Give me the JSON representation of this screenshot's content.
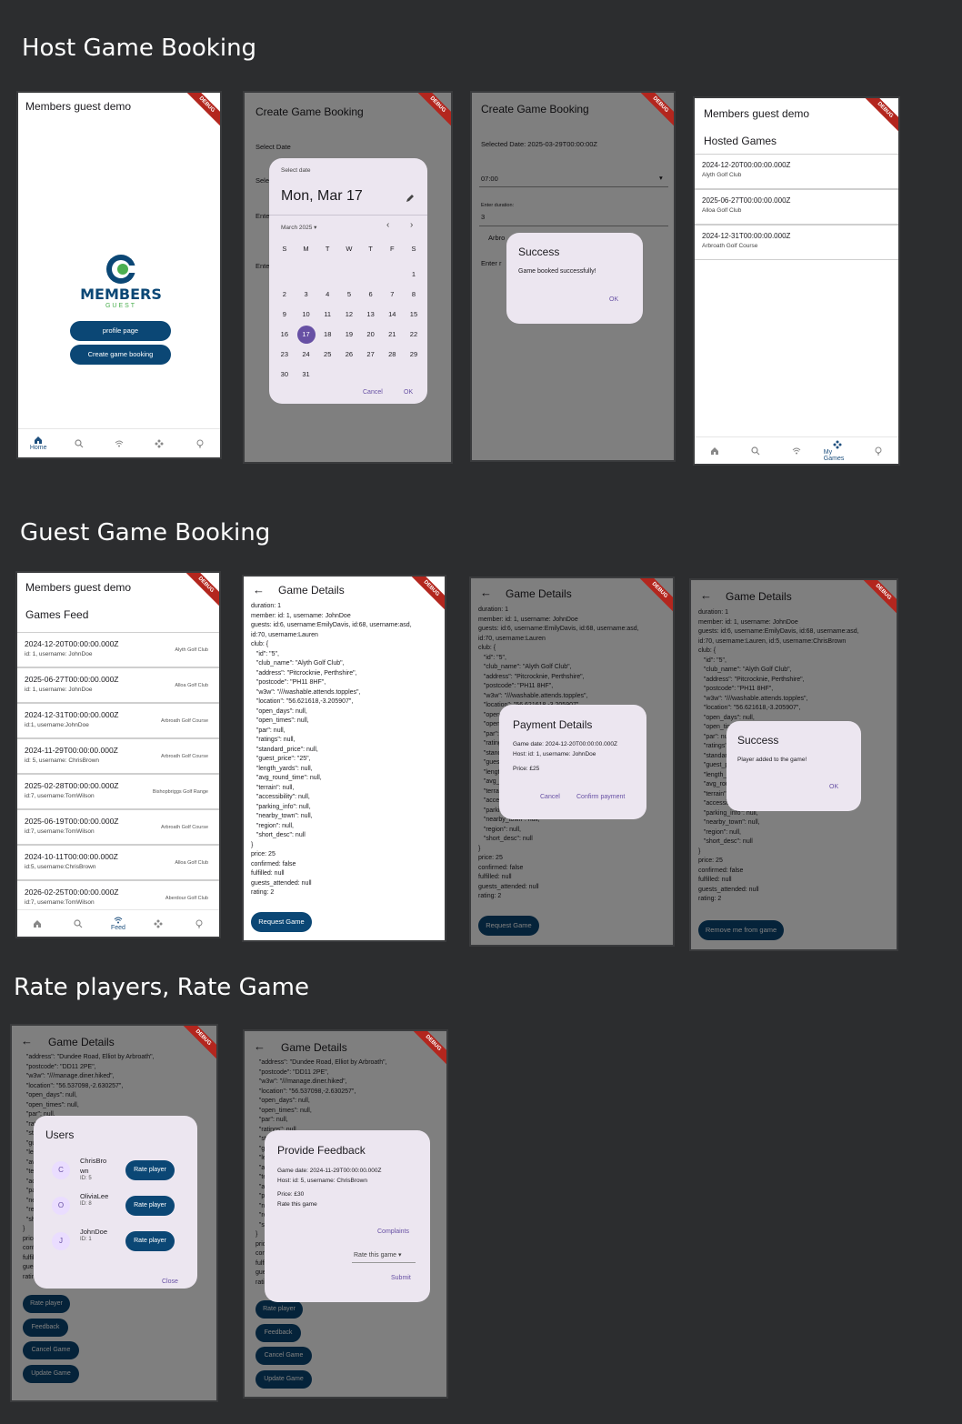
{
  "sections": {
    "host": "Host Game Booking",
    "guest": "Guest Game Booking",
    "rate": "Rate players, Rate Game"
  },
  "debug_label": "DEBUG",
  "app_title": "Members guest demo",
  "logo": {
    "word": "MEMBERS",
    "sub": "GUEST"
  },
  "home": {
    "profile_btn": "profile page",
    "create_btn": "Create game booking"
  },
  "nav": {
    "home": "Home",
    "feed": "Feed",
    "my_games": "My Games"
  },
  "create": {
    "title": "Create Game Booking",
    "select_date": "Select Date",
    "select_prefix": "Sele",
    "enter_prefix": "Ente"
  },
  "datepicker": {
    "label": "Select date",
    "header": "Mon, Mar 17",
    "month": "March 2025",
    "weekdays": [
      "S",
      "M",
      "T",
      "W",
      "T",
      "F",
      "S"
    ],
    "days": [
      "1",
      "2",
      "3",
      "4",
      "5",
      "6",
      "7",
      "8",
      "9",
      "10",
      "11",
      "12",
      "13",
      "14",
      "15",
      "16",
      "17",
      "18",
      "19",
      "20",
      "21",
      "22",
      "23",
      "24",
      "25",
      "26",
      "27",
      "28",
      "29",
      "30",
      "31"
    ],
    "selected": "17",
    "cancel": "Cancel",
    "ok": "OK"
  },
  "booked": {
    "selected_date": "Selected Date: 2025-03-29T00:00:00Z",
    "time": "07:00",
    "duration_label": "Enter duration:",
    "duration": "3",
    "club_prefix": "Arbro",
    "enter_prefix": "Enter r",
    "dialog_title": "Success",
    "dialog_msg": "Game booked successfully!",
    "ok": "OK"
  },
  "hosted": {
    "title": "Hosted Games",
    "rows": [
      {
        "date": "2024-12-20T00:00:00.000Z",
        "club": "Alyth Golf Club"
      },
      {
        "date": "2025-06-27T00:00:00.000Z",
        "club": "Alloa Golf Club"
      },
      {
        "date": "2024-12-31T00:00:00.000Z",
        "club": "Arbroath Golf Course"
      }
    ]
  },
  "feed": {
    "title": "Games Feed",
    "rows": [
      {
        "date": "2024-12-20T00:00:00.000Z",
        "sub": "id: 1, username: JohnDoe",
        "club": "Alyth Golf Club"
      },
      {
        "date": "2025-06-27T00:00:00.000Z",
        "sub": "id: 1, username: JohnDoe",
        "club": "Alloa Golf Club"
      },
      {
        "date": "2024-12-31T00:00:00.000Z",
        "sub": "id:1, username:JohnDoe",
        "club": "Arbroath Golf Course"
      },
      {
        "date": "2024-11-29T00:00:00.000Z",
        "sub": "id: 5, username: ChrisBrown",
        "club": "Arbroath Golf Course"
      },
      {
        "date": "2025-02-28T00:00:00.000Z",
        "sub": "id:7, username:TomWilson",
        "club": "Bishopbriggs Golf Range"
      },
      {
        "date": "2025-06-19T00:00:00.000Z",
        "sub": "id:7, username:TomWilson",
        "club": "Arbroath Golf Course"
      },
      {
        "date": "2024-10-11T00:00:00.000Z",
        "sub": "id:5, username:ChrisBrown",
        "club": "Alloa Golf Club"
      },
      {
        "date": "2026-02-25T00:00:00.000Z",
        "sub": "id:7, username:TomWilson",
        "club": "Aberdour Golf Club"
      }
    ]
  },
  "details": {
    "title": "Game Details",
    "body": "duration: 1\nmember: id: 1, username: JohnDoe\nguests: id:6, username:EmilyDavis, id:68, username:asd,\nid:70, username:Lauren\nclub: {\n   \"id\": \"5\",\n   \"club_name\": \"Alyth Golf Club\",\n   \"address\": \"Pitcrocknie, Perthshire\",\n   \"postcode\": \"PH11 8HF\",\n   \"w3w\": \"///washable.attends.topples\",\n   \"location\": \"56.621618,-3.205907\",\n   \"open_days\": null,\n   \"open_times\": null,\n   \"par\": null,\n   \"ratings\": null,\n   \"standard_price\": null,\n   \"guest_price\": \"25\",\n   \"length_yards\": null,\n   \"avg_round_time\": null,\n   \"terrain\": null,\n   \"accessibility\": null,\n   \"parking_info\": null,\n   \"nearby_town\": null,\n   \"region\": null,\n   \"short_desc\": null\n}\nprice: 25\nconfirmed: false\nfulfilled: null\nguests_attended: null\nrating: 2",
    "body_joined": "duration: 1\nmember: id: 1, username: JohnDoe\nguests: id:6, username:EmilyDavis, id:68, username:asd,\nid:70, username:Lauren, id:5, username:ChrisBrown\nclub: {\n   \"id\": \"5\",\n   \"club_name\": \"Alyth Golf Club\",\n   \"address\": \"Pitcrocknie, Perthshire\",\n   \"postcode\": \"PH11 8HF\",\n   \"w3w\": \"///washable.attends.topples\",\n   \"location\": \"56.621618,-3.205907\",\n   \"open_days\": null,\n   \"open_times\": null,\n   \"par\": null,\n   \"ratings\": null,\n   \"standard_price\": null,\n   \"guest_price\": \"25\",\n   \"length_yards\": null,\n   \"avg_round_time\": null,\n   \"terrain\": null,\n   \"accessibility\": null,\n   \"parking_info\": null,\n   \"nearby_town\": null,\n   \"region\": null,\n   \"short_desc\": null\n}\nprice: 25\nconfirmed: false\nfulfilled: null\nguests_attended: null\nrating: 2",
    "request_btn": "Request Game",
    "remove_btn": "Remove me from game"
  },
  "payment": {
    "title": "Payment Details",
    "date": "Game date: 2024-12-20T00:00:00.000Z",
    "host": "Host: id: 1, username: JohnDoe",
    "price": "Price: £25",
    "cancel": "Cancel",
    "confirm": "Confirm payment"
  },
  "player_added": {
    "title": "Success",
    "msg": "Player added to the game!",
    "ok": "OK"
  },
  "rate_body": "  \"address\": \"Dundee Road, Elliot by Arbroath\",\n  \"postcode\": \"DD11 2PE\",\n  \"w3w\": \"///manage.diner.hiked\",\n  \"location\": \"56.537098,-2.630257\",\n  \"open_days\": null,\n  \"open_times\": null,\n  \"par\": null,\n  \"ratings\": null,\n  \"standard_price\": null,\n  \"guest_price\": \"30\",\n  \"length_yards\": null,\n  \"avg_round_time\": null,\n  \"terrain\": null,\n  \"accessibility\": null,\n  \"parking_info\": null,\n  \"nearby_town\": null,\n  \"region\": null,\n  \"short_desc\": null\n}\nprice: 30\nconfirmed: true\nfulfilled: true\nguests_attended: null\nrating: 2",
  "users_dialog": {
    "title": "Users",
    "users": [
      {
        "initial": "C",
        "name1": "ChrisBro",
        "name2": "wn",
        "id": "ID: 5"
      },
      {
        "initial": "O",
        "name1": "OliviaLee",
        "name2": "",
        "id": "ID: 8"
      },
      {
        "initial": "J",
        "name1": "JohnDoe",
        "name2": "",
        "id": "ID: 1"
      }
    ],
    "rate_btn": "Rate player",
    "close": "Close"
  },
  "rate_actions": [
    "Rate player",
    "Feedback",
    "Cancel Game",
    "Update Game"
  ],
  "feedback": {
    "title": "Provide Feedback",
    "date": "Game date: 2024-11-29T00:00:00.000Z",
    "host": "Host: id: 5, username: ChrisBrown",
    "price": "Price: £30",
    "rate_label": "Rate this game",
    "complaints": "Complaints",
    "dropdown": "Rate this game",
    "submit": "Submit"
  },
  "icons": [
    "home-icon",
    "search-icon",
    "wifi-icon",
    "gamepad-icon",
    "lightbulb-icon",
    "pencil-icon",
    "back-arrow-icon",
    "chevron-left-icon",
    "chevron-right-icon",
    "dropdown-arrow-icon"
  ]
}
